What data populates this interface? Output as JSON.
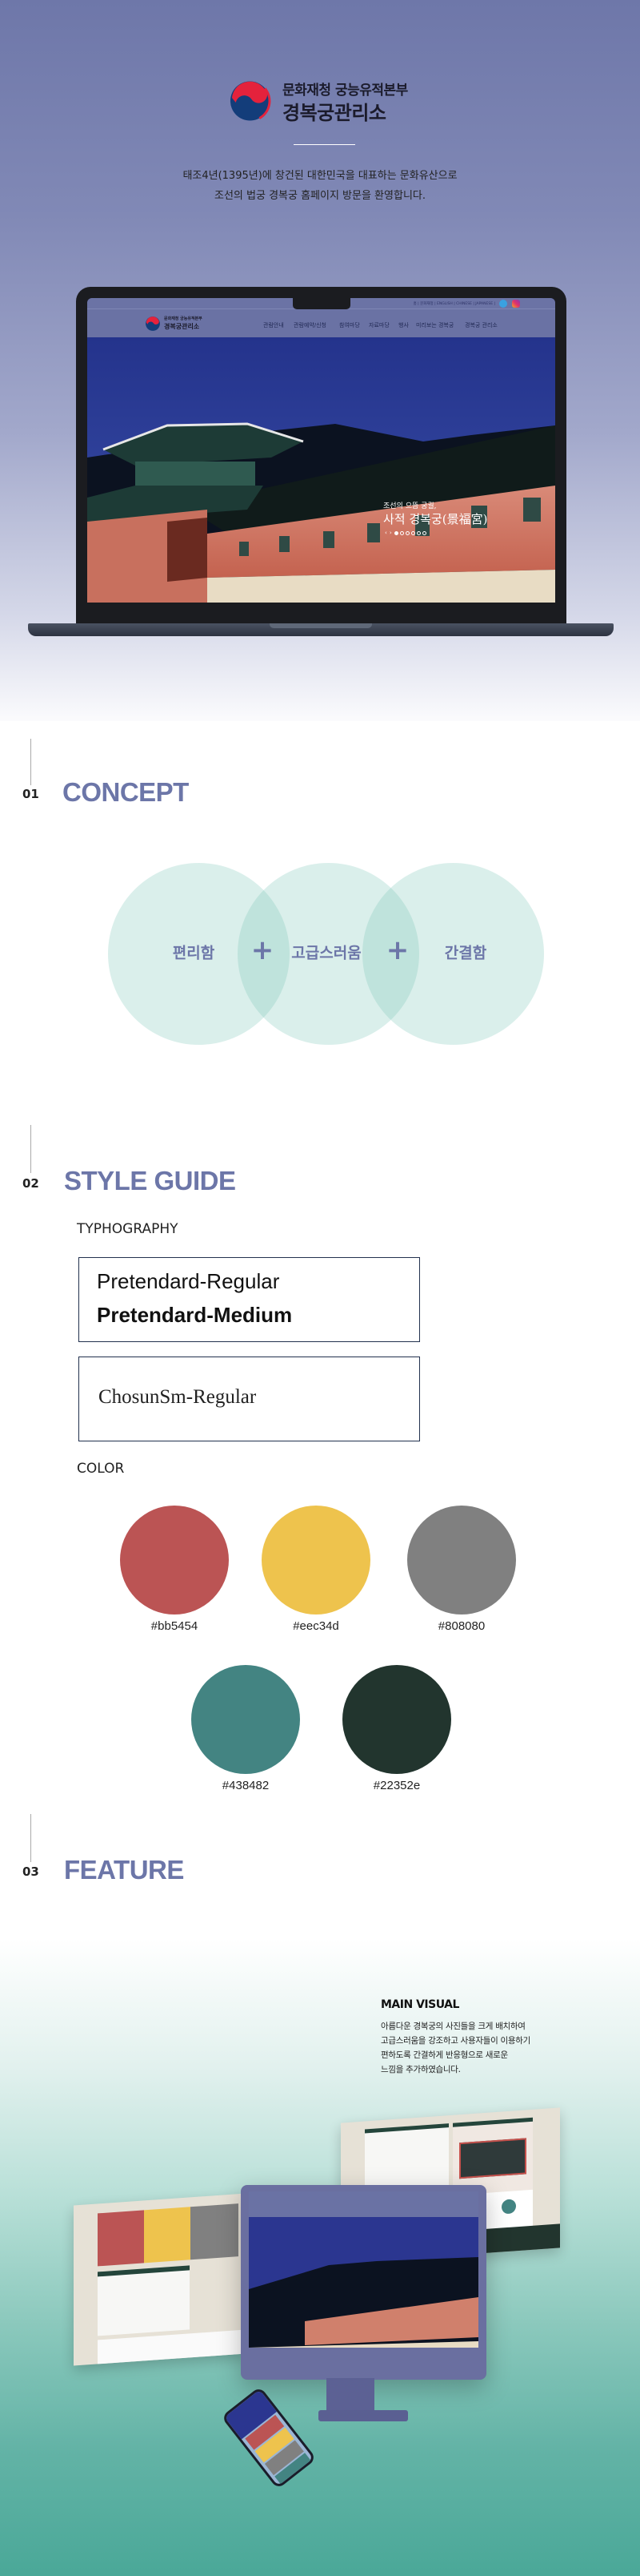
{
  "header": {
    "logo_line1": "문화재청 궁능유적본부",
    "logo_line2": "경복궁관리소",
    "intro_line1": "태조4년(1395년)에 창건된 대한민국을 대표하는 문화유산으로",
    "intro_line2": "조선의 법궁 경복궁 홈페이지 방문을 환영합니다."
  },
  "mockup_site": {
    "util_links": "홈 | 문화재청 | ENGLISH | CHINESE | JAPANESE |",
    "logo_line1": "문화재청 궁능유적본부",
    "logo_line2": "경복궁관리소",
    "nav": [
      "관람안내",
      "관람예약/신청",
      "참여마당",
      "자료마당",
      "행사",
      "미리보는 경복궁",
      "경복궁 관리소"
    ],
    "hero_sub": "조선의 으뜸 궁궐,",
    "hero_title": "사적 경복궁(景福宮)",
    "slide_count": 6,
    "active_slide": 1
  },
  "sections": {
    "concept": {
      "num": "01",
      "title": "CONCEPT",
      "items": [
        "편리함",
        "고급스러움",
        "간결함"
      ],
      "plus": "+"
    },
    "style_guide": {
      "num": "02",
      "title": "STYLE GUIDE",
      "typography_label": "TYPHOGRAPHY",
      "fonts": [
        "Pretendard-Regular",
        "Pretendard-Medium",
        "ChosunSm-Regular"
      ],
      "color_label": "COLOR",
      "colors": [
        "#bb5454",
        "#eec34d",
        "#808080",
        "#438482",
        "#22352e"
      ]
    },
    "feature": {
      "num": "03",
      "title": "FEATURE",
      "main_visual_title": "MAIN VISUAL",
      "main_visual_lines": [
        "아름다운 경복궁의 사진들을 크게 배치하여",
        "고급스러움을 강조하고 사용자들이 이용하기",
        "편하도록 간결하게 반응형으로 새로운",
        "느낌을 추가하였습니다."
      ]
    }
  },
  "colors": {
    "accent": "#6c76a8",
    "concept_circle": "#d8eeea",
    "feature_bottom": "#4aa898"
  }
}
